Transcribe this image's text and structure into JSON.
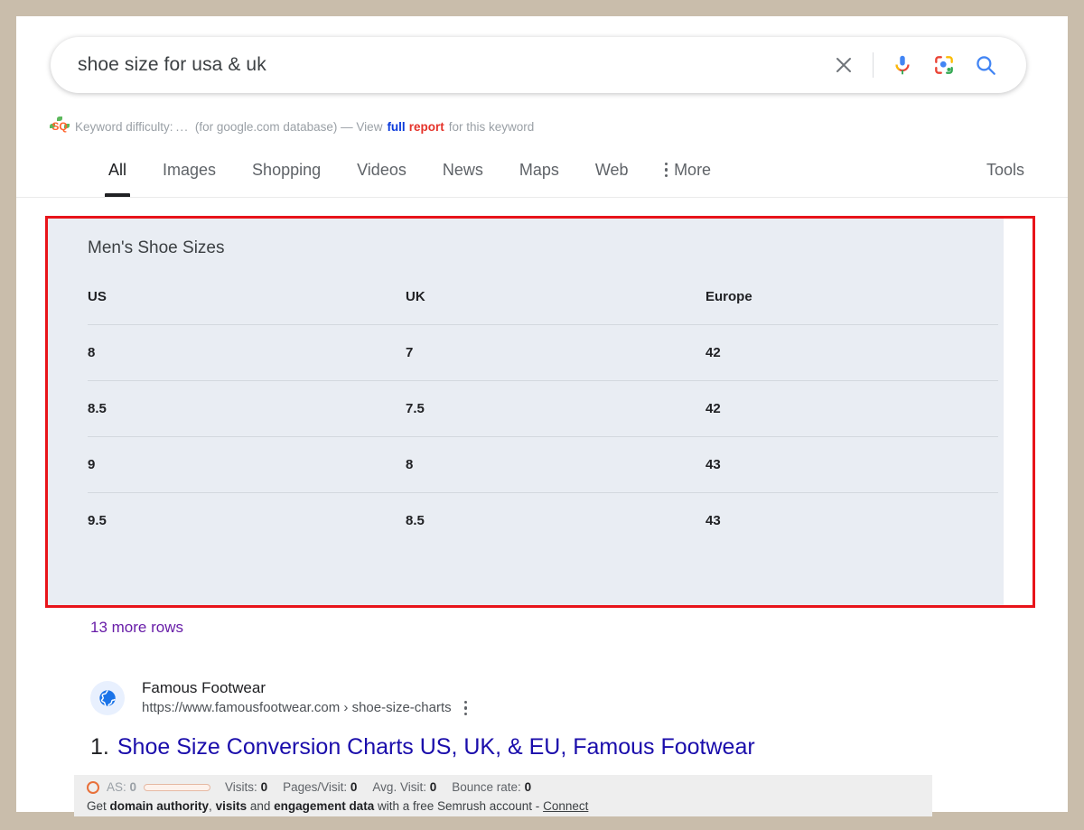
{
  "search": {
    "query": "shoe size for usa & uk",
    "clear_icon": "close-icon",
    "mic_icon": "microphone-icon",
    "lens_icon": "google-lens-icon",
    "search_icon": "search-icon"
  },
  "keyword_difficulty": {
    "badge_icon": "semrush-icon",
    "prefix": "Keyword difficulty:",
    "dots": "...",
    "database": "(for google.com database) — View",
    "link_part1": "full",
    "link_part2": "report",
    "suffix": "for this keyword"
  },
  "tabs": {
    "items": [
      {
        "label": "All",
        "active": true
      },
      {
        "label": "Images",
        "active": false
      },
      {
        "label": "Shopping",
        "active": false
      },
      {
        "label": "Videos",
        "active": false
      },
      {
        "label": "News",
        "active": false
      },
      {
        "label": "Maps",
        "active": false
      },
      {
        "label": "Web",
        "active": false
      }
    ],
    "more_label": "More",
    "more_icon": "kebab-menu-icon",
    "tools_label": "Tools"
  },
  "size_table": {
    "title": "Men's Shoe Sizes",
    "columns": [
      "US",
      "UK",
      "Europe"
    ],
    "rows": [
      [
        "8",
        "7",
        "42"
      ],
      [
        "8.5",
        "7.5",
        "42"
      ],
      [
        "9",
        "8",
        "43"
      ],
      [
        "9.5",
        "8.5",
        "43"
      ]
    ],
    "more_rows_label": "13 more rows",
    "highlight_color": "#e8141a",
    "panel_color": "#e9edf3"
  },
  "result": {
    "favicon_icon": "globe-icon",
    "site_name": "Famous Footwear",
    "url": "https://www.famousfootwear.com › shoe-size-charts",
    "kebab_icon": "kebab-menu-icon",
    "rank": "1.",
    "title": "Shoe Size Conversion Charts US, UK, & EU, Famous Footwear"
  },
  "semrush_bar": {
    "as_icon": "authority-score-icon",
    "as_label": "AS:",
    "as_value": "0",
    "metrics": [
      {
        "label": "Visits:",
        "value": "0"
      },
      {
        "label": "Pages/Visit:",
        "value": "0"
      },
      {
        "label": "Avg. Visit:",
        "value": "0"
      },
      {
        "label": "Bounce rate:",
        "value": "0"
      }
    ],
    "cta_prefix": "Get",
    "cta_bold1": "domain authority",
    "cta_mid1": ",",
    "cta_bold2": "visits",
    "cta_mid2": "and",
    "cta_bold3": "engagement data",
    "cta_suffix": "with a free Semrush account -",
    "cta_link": "Connect"
  }
}
